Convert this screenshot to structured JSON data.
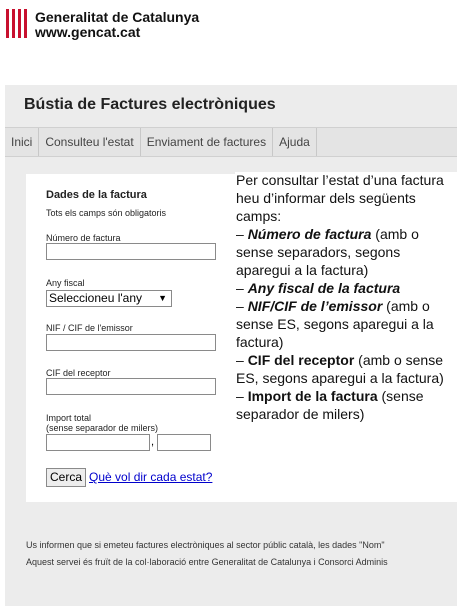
{
  "header": {
    "org_name": "Generalitat de Catalunya",
    "org_url": "www.gencat.cat",
    "logo_icon": "senyera-logo-icon"
  },
  "app_title": "Bústia de Factures electròniques",
  "tabs": [
    "Inici",
    "Consulteu l'estat",
    "Enviament de factures",
    "Ajuda"
  ],
  "form": {
    "title": "Dades de la factura",
    "note": "Tots els camps són obligatoris",
    "invoice_number_label": "Número de factura",
    "invoice_number_value": "",
    "fiscal_year_label": "Any fiscal",
    "fiscal_year_selected": "Seleccioneu l'any",
    "issuer_nif_label": "NIF / CIF de l'emissor",
    "issuer_nif_value": "",
    "receiver_cif_label": "CIF del receptor",
    "receiver_cif_value": "",
    "total_label": "Import total",
    "total_sublabel": "(sense separador de milers)",
    "total_integer_value": "",
    "total_decimal_value": "",
    "decimal_separator": ",",
    "search_button": "Cerca",
    "help_link": "Què vol dir cada estat?"
  },
  "info": {
    "intro": "Per consultar l’estat d’una factura heu d’informar dels següents camps:",
    "items": [
      {
        "dash": "– ",
        "label": "Número de factura",
        "note": " (amb o sense separadors, segons aparegui a la factura)"
      },
      {
        "dash": "– ",
        "label": "Any fiscal de la factura",
        "note": ""
      },
      {
        "dash": "– ",
        "label": "NIF/CIF de l’emissor",
        "note": " (amb o sense ES, segons aparegui a la factura)"
      },
      {
        "dash": "– ",
        "label": "CIF del receptor",
        "note": " (amb o sense ES, segons aparegui a la factura)"
      },
      {
        "dash": "– ",
        "label": "Import de la factura",
        "note": " (sense separador de milers)"
      }
    ]
  },
  "footer": {
    "line1": "Us informen que si emeteu factures electròniques al sector públic català, les dades \"Nom\"",
    "line2": "Aquest servei és fruït de la col·laboració entre Generalitat de Catalunya i Consorci Adminis"
  },
  "colors": {
    "logo_red": "#c8102e",
    "link": "#0000cc",
    "band": "#ececec",
    "tabbar": "#e4e4e4"
  }
}
